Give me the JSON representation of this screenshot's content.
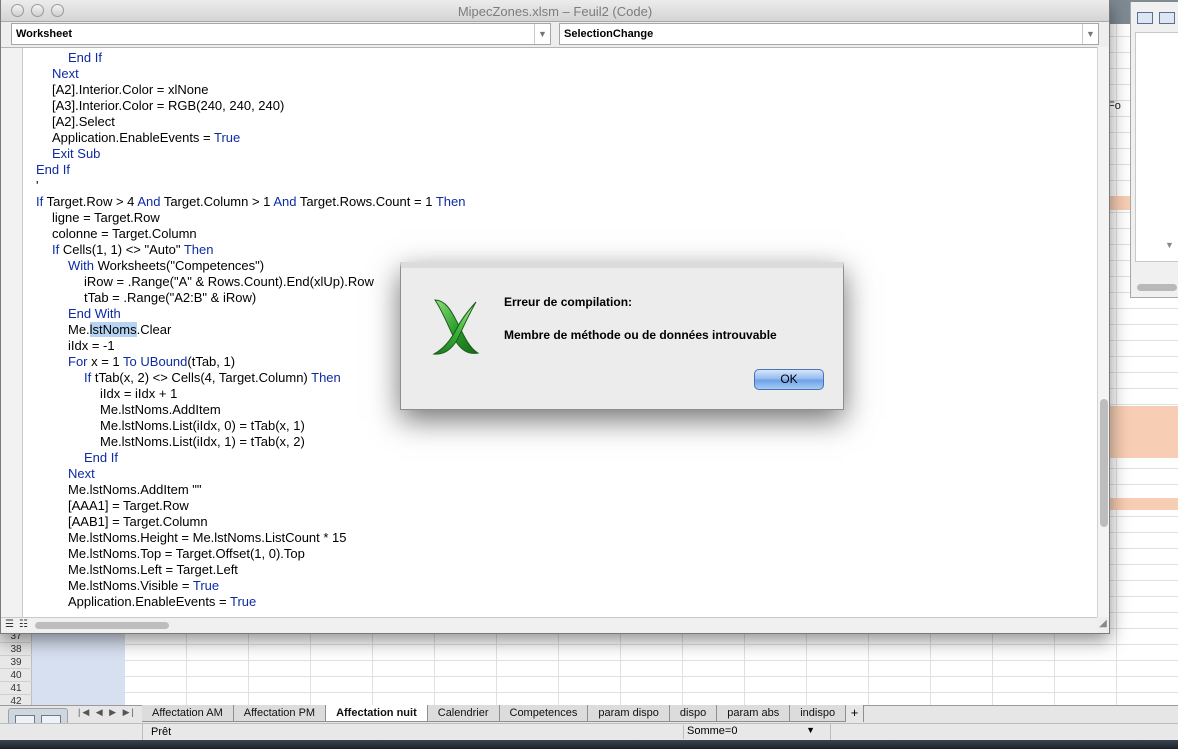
{
  "window": {
    "title": "MipecZones.xlsm – Feuil2 (Code)"
  },
  "editor": {
    "object_dropdown": "Worksheet",
    "procedure_dropdown": "SelectionChange",
    "code_lines": [
      {
        "indent": 2,
        "parts": [
          {
            "t": "End If",
            "k": 1
          }
        ]
      },
      {
        "indent": 1,
        "parts": [
          {
            "t": "Next",
            "k": 1
          }
        ]
      },
      {
        "indent": 1,
        "parts": [
          {
            "t": "[A2].Interior.Color = xlNone"
          }
        ]
      },
      {
        "indent": 1,
        "parts": [
          {
            "t": "[A3].Interior.Color = RGB(240, 240, 240)"
          }
        ]
      },
      {
        "indent": 1,
        "parts": [
          {
            "t": "[A2].Select"
          }
        ]
      },
      {
        "indent": 1,
        "parts": [
          {
            "t": "Application.EnableEvents = "
          },
          {
            "t": "True",
            "k": 1
          }
        ]
      },
      {
        "indent": 1,
        "parts": [
          {
            "t": "Exit Sub",
            "k": 1
          }
        ]
      },
      {
        "indent": 0,
        "parts": [
          {
            "t": "End If",
            "k": 1
          }
        ]
      },
      {
        "indent": 0,
        "parts": [
          {
            "t": "'"
          }
        ]
      },
      {
        "indent": 0,
        "parts": [
          {
            "t": "If",
            "k": 1
          },
          {
            "t": " Target.Row > 4 "
          },
          {
            "t": "And",
            "k": 1
          },
          {
            "t": " Target.Column > 1 "
          },
          {
            "t": "And",
            "k": 1
          },
          {
            "t": " Target.Rows.Count = 1 "
          },
          {
            "t": "Then",
            "k": 1
          }
        ]
      },
      {
        "indent": 1,
        "parts": [
          {
            "t": "ligne = Target.Row"
          }
        ]
      },
      {
        "indent": 1,
        "parts": [
          {
            "t": "colonne = Target.Column"
          }
        ]
      },
      {
        "indent": 1,
        "parts": [
          {
            "t": "If",
            "k": 1
          },
          {
            "t": " Cells(1, 1) <> \"Auto\" "
          },
          {
            "t": "Then",
            "k": 1
          }
        ]
      },
      {
        "indent": 2,
        "parts": [
          {
            "t": "With",
            "k": 1
          },
          {
            "t": " Worksheets(\"Competences\")"
          }
        ]
      },
      {
        "indent": 3,
        "parts": [
          {
            "t": "iRow = .Range(\"A\" & Rows.Count).End(xlUp).Row"
          }
        ]
      },
      {
        "indent": 3,
        "parts": [
          {
            "t": "tTab = .Range(\"A2:B\" & iRow)"
          }
        ]
      },
      {
        "indent": 2,
        "parts": [
          {
            "t": "End With",
            "k": 1
          }
        ]
      },
      {
        "indent": 2,
        "parts": [
          {
            "t": "Me."
          },
          {
            "t": "lstNoms",
            "s": 1
          },
          {
            "t": ".Clear"
          }
        ]
      },
      {
        "indent": 2,
        "parts": [
          {
            "t": "iIdx = -1"
          }
        ]
      },
      {
        "indent": 2,
        "parts": [
          {
            "t": "For",
            "k": 1
          },
          {
            "t": " x = 1 "
          },
          {
            "t": "To",
            "k": 1
          },
          {
            "t": " "
          },
          {
            "t": "UBound",
            "k": 1
          },
          {
            "t": "(tTab, 1)"
          }
        ]
      },
      {
        "indent": 3,
        "parts": [
          {
            "t": "If",
            "k": 1
          },
          {
            "t": " tTab(x, 2) <> Cells(4, Target.Column) "
          },
          {
            "t": "Then",
            "k": 1
          }
        ]
      },
      {
        "indent": 4,
        "parts": [
          {
            "t": "iIdx = iIdx + 1"
          }
        ]
      },
      {
        "indent": 4,
        "parts": [
          {
            "t": "Me.lstNoms.AddItem"
          }
        ]
      },
      {
        "indent": 4,
        "parts": [
          {
            "t": "Me.lstNoms.List(iIdx, 0) = tTab(x, 1)"
          }
        ]
      },
      {
        "indent": 4,
        "parts": [
          {
            "t": "Me.lstNoms.List(iIdx, 1) = tTab(x, 2)"
          }
        ]
      },
      {
        "indent": 3,
        "parts": [
          {
            "t": "End If",
            "k": 1
          }
        ]
      },
      {
        "indent": 2,
        "parts": [
          {
            "t": "Next",
            "k": 1
          }
        ]
      },
      {
        "indent": 2,
        "parts": [
          {
            "t": "Me.lstNoms.AddItem \"\""
          }
        ]
      },
      {
        "indent": 2,
        "parts": [
          {
            "t": "[AAA1] = Target.Row"
          }
        ]
      },
      {
        "indent": 2,
        "parts": [
          {
            "t": "[AAB1] = Target.Column"
          }
        ]
      },
      {
        "indent": 2,
        "parts": [
          {
            "t": "Me.lstNoms.Height = Me.lstNoms.ListCount * 15"
          }
        ]
      },
      {
        "indent": 2,
        "parts": [
          {
            "t": "Me.lstNoms.Top = Target.Offset(1, 0).Top"
          }
        ]
      },
      {
        "indent": 2,
        "parts": [
          {
            "t": "Me.lstNoms.Left = Target.Left"
          }
        ]
      },
      {
        "indent": 2,
        "parts": [
          {
            "t": "Me.lstNoms.Visible = "
          },
          {
            "t": "True",
            "k": 1
          }
        ]
      },
      {
        "indent": 2,
        "parts": [
          {
            "t": "Application.EnableEvents = "
          },
          {
            "t": "True",
            "k": 1
          }
        ]
      }
    ]
  },
  "dialog": {
    "title": "Erreur de compilation:",
    "message": "Membre de méthode ou de données introuvable",
    "ok_label": "OK",
    "icon": "excel-logo-icon"
  },
  "sheet": {
    "row_numbers": [
      "37",
      "38",
      "39",
      "40",
      "41",
      "42"
    ],
    "tabs": [
      "Affectation AM",
      "Affectation PM",
      "Affectation nuit",
      "Calendrier",
      "Competences",
      "param dispo",
      "dispo",
      "param abs",
      "indispo"
    ],
    "active_tab": "Affectation nuit",
    "add_tab_label": "+",
    "side_label": "Fo"
  },
  "status": {
    "ready": "Prêt",
    "sum": "Somme=0"
  },
  "colors": {
    "keyword": "#0d2ba3",
    "highlight_band": "#f7cdb3",
    "selection": "#b6d4f2"
  }
}
